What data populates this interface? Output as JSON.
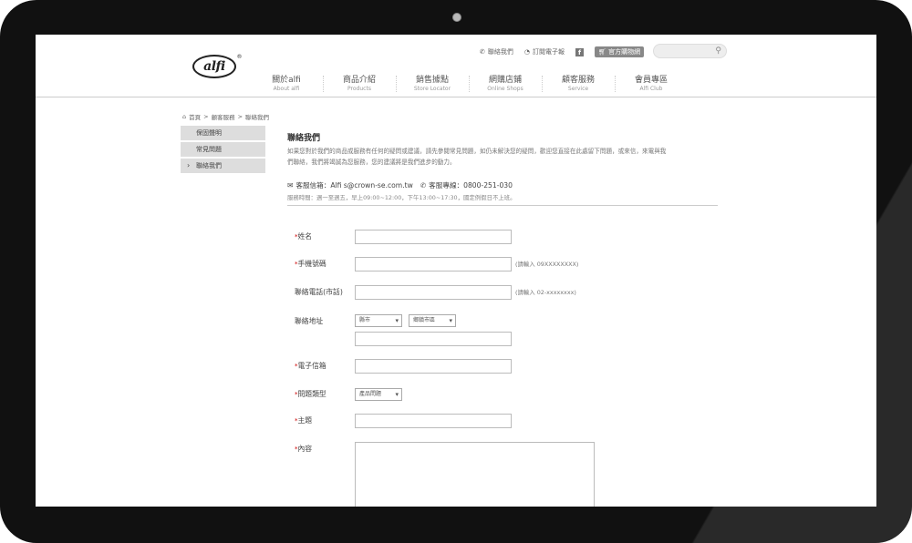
{
  "header": {
    "logo_text": "alfi",
    "logo_mark": "®",
    "toplinks": [
      {
        "label": "聯絡我們",
        "icon": "phone-icon"
      },
      {
        "label": "訂閱電子報",
        "icon": "rss-icon"
      },
      {
        "label": "f",
        "icon": "facebook-icon"
      }
    ],
    "shop_badge": "官方購物網",
    "search_placeholder": "",
    "nav": [
      {
        "zh": "關於alfi",
        "en": "About alfi"
      },
      {
        "zh": "商品介紹",
        "en": "Products"
      },
      {
        "zh": "銷售據點",
        "en": "Store Locator"
      },
      {
        "zh": "網購店鋪",
        "en": "Online Shops"
      },
      {
        "zh": "顧客服務",
        "en": "Service"
      },
      {
        "zh": "會員專區",
        "en": "Alfi Club"
      }
    ]
  },
  "breadcrumb": [
    "首頁",
    ">",
    "顧客服務",
    ">",
    "聯絡我們"
  ],
  "sidebar": {
    "items": [
      {
        "label": "保固聲明"
      },
      {
        "label": "常見問題"
      },
      {
        "label": "聯絡我們"
      }
    ]
  },
  "content": {
    "title": "聯絡我們",
    "intro": "如果您對於我們的商品或服務有任何的疑問或建議，請先參閱常見問題，如仍未解決您的疑問，歡迎您直接在此處留下問題，或來信，來電與我們聯絡，我們將竭誠為您服務，您的建議將是我們進步的動力。",
    "email_label": "客服信箱：Alfi s@crown-se.com.tw",
    "phone_label": "客服專線：0800-251-030",
    "hours": "服務時間：週一至週五，早上09:00~12:00，下午13:00~17:30，國定例假日不上班。"
  },
  "form": {
    "required_mark": "*",
    "name_label": "姓名",
    "mobile_label": "手機號碼",
    "mobile_hint": "(請輸入 09XXXXXXXX)",
    "phone_label": "聯絡電話(市話)",
    "phone_hint": "(請輸入 02-xxxxxxxx)",
    "address_label": "聯絡地址",
    "county_select": "縣市",
    "district_select": "鄉鎮市區",
    "email_label": "電子信箱",
    "type_label": "問題類型",
    "type_select": "產品問題",
    "subject_label": "主題",
    "content_label": "內容"
  }
}
